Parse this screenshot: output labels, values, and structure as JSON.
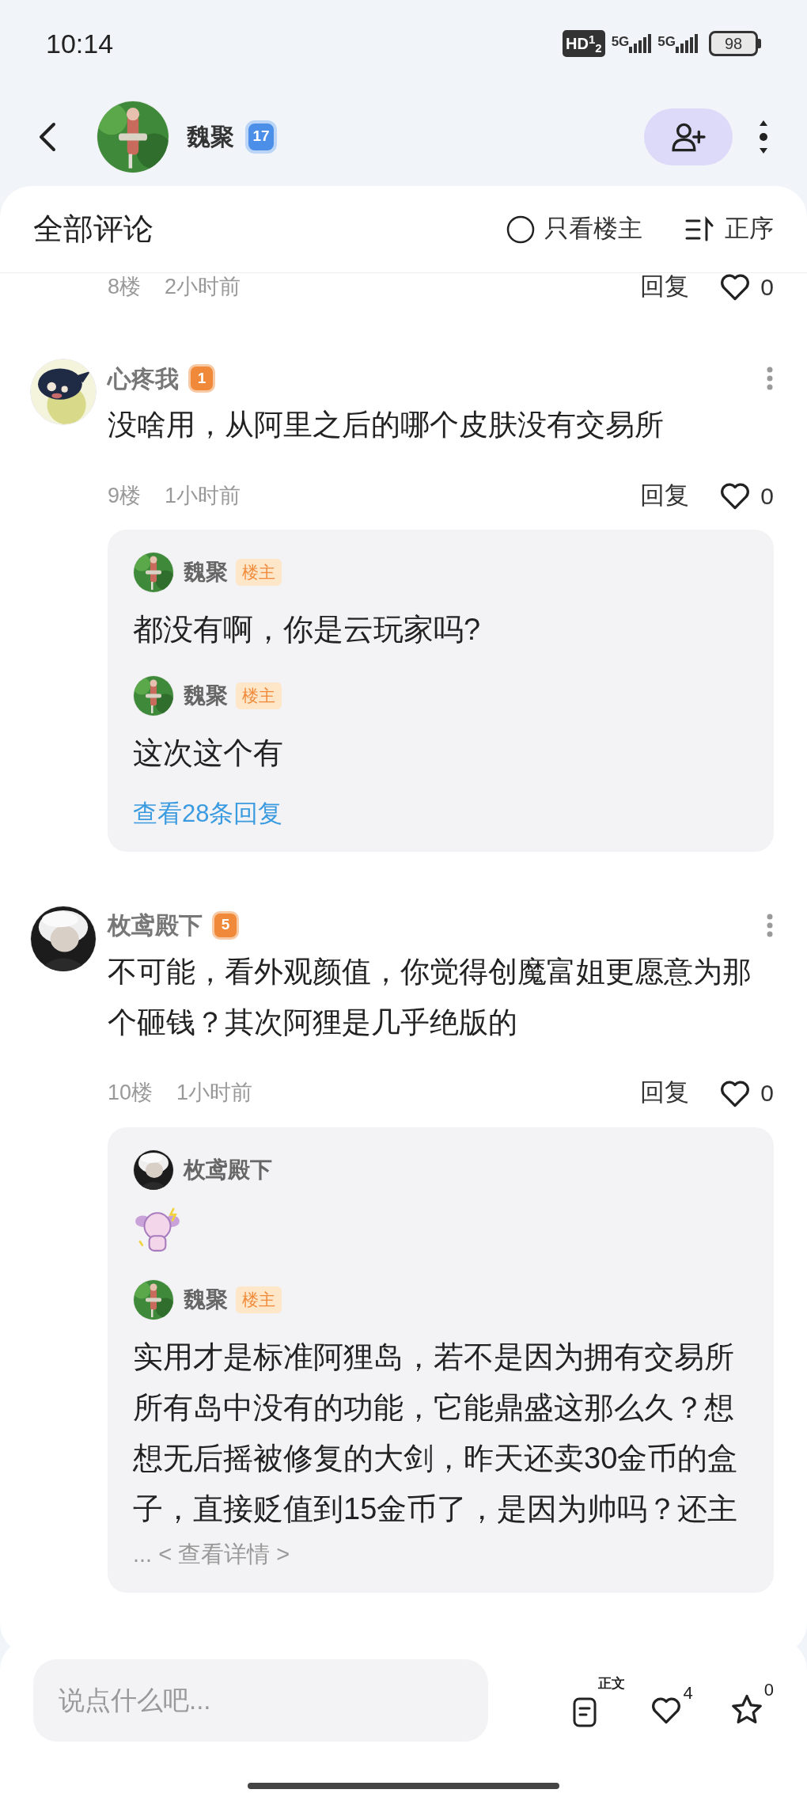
{
  "status_bar": {
    "time": "10:14",
    "hd": "HD$^{1}$$_{2}$",
    "networks": [
      "5G",
      "5G"
    ],
    "battery": "98"
  },
  "header": {
    "user": "魏聚",
    "level": "17"
  },
  "comments_header": {
    "title": "全部评论",
    "op_only": {
      "label": "只看楼主",
      "checked": false
    },
    "sort": "正序"
  },
  "previous_comment": {
    "floor": "8楼",
    "time": "2小时前",
    "reply": "回复",
    "likes": "0",
    "liked": false
  },
  "comments": [
    {
      "author": "心疼我",
      "level": "1",
      "text": "没啥用，从阿里之后的哪个皮肤没有交易所",
      "floor": "9楼",
      "time": "1小时前",
      "reply": "回复",
      "likes": "0",
      "liked": false,
      "replies": [
        {
          "author": "魏聚",
          "op_tag": "楼主",
          "kind": "text",
          "text": "都没有啊，你是云玩家吗?"
        },
        {
          "author": "魏聚",
          "op_tag": "楼主",
          "kind": "text",
          "text": "这次这个有"
        }
      ],
      "view_replies": "查看28条回复"
    },
    {
      "author": "枚鸢殿下",
      "level": "5",
      "text": "不可能，看外观颜值，你觉得创魔富姐更愿意为那个砸钱？其次阿狸是几乎绝版的",
      "floor": "10楼",
      "time": "1小时前",
      "reply": "回复",
      "likes": "0",
      "liked": false,
      "replies": [
        {
          "author": "枚鸢殿下",
          "kind": "sticker"
        },
        {
          "author": "魏聚",
          "op_tag": "楼主",
          "kind": "text",
          "text": "实用才是标准阿狸岛，若不是因为拥有交易所所有岛中没有的功能，它能鼎盛这那么久？想想无后摇被修复的大剑，昨天还卖30金币的盒子，直接贬值到15金币了，是因为帅吗？还主",
          "more": "... < 查看详情 >"
        }
      ]
    }
  ],
  "composer": {
    "placeholder": "说点什么吧...",
    "post_label": "正文",
    "likes": "4",
    "favorites": "0"
  }
}
